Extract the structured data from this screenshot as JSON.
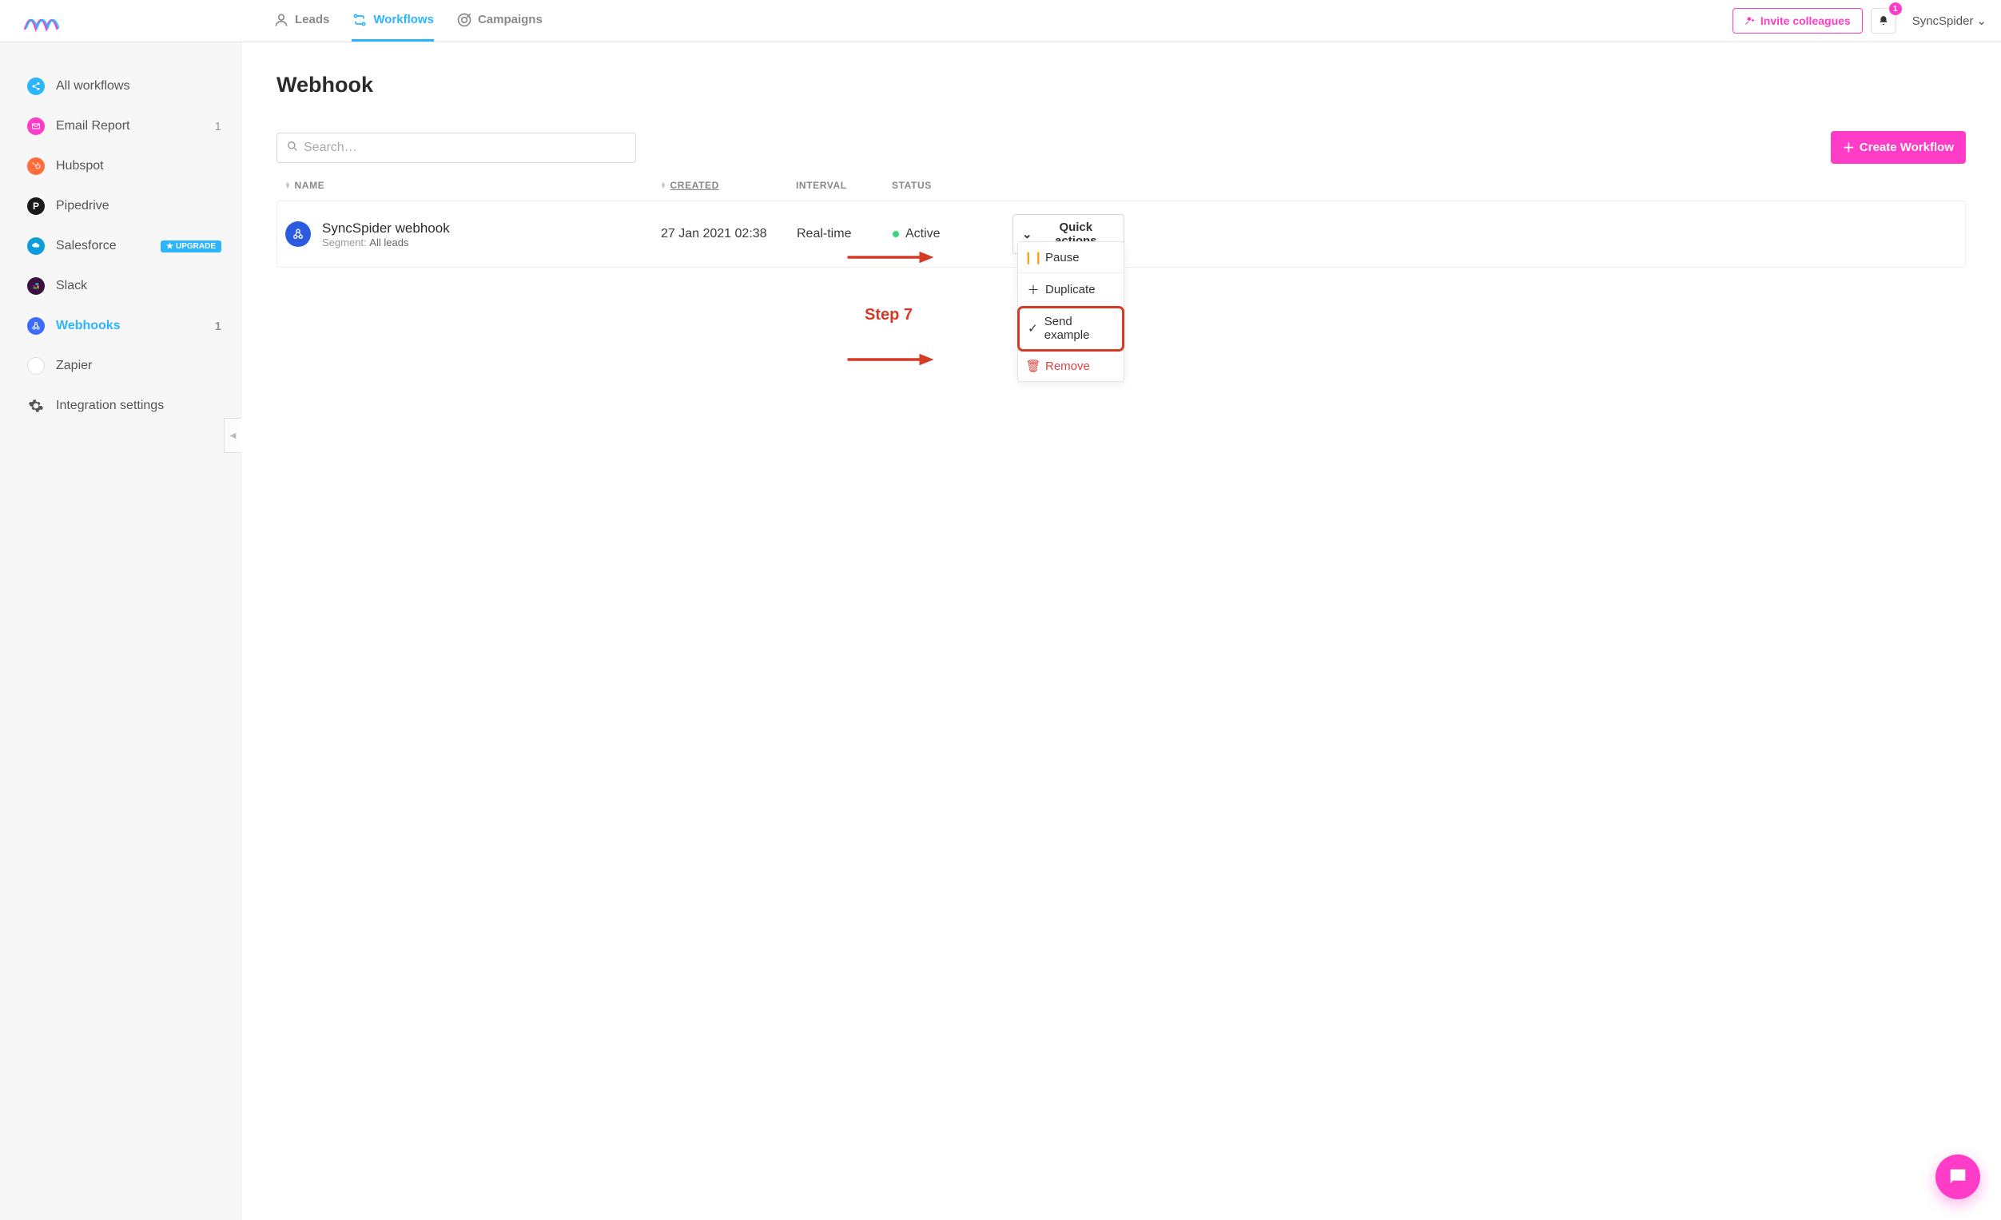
{
  "topnav": {
    "leads": "Leads",
    "workflows": "Workflows",
    "campaigns": "Campaigns"
  },
  "topright": {
    "invite_label": "Invite colleagues",
    "notif_count": "1",
    "user_label": "SyncSpider"
  },
  "sidebar": {
    "all_workflows": "All workflows",
    "email_report": {
      "label": "Email Report",
      "count": "1"
    },
    "hubspot": "Hubspot",
    "pipedrive": "Pipedrive",
    "salesforce": {
      "label": "Salesforce",
      "badge": "UPGRADE"
    },
    "slack": "Slack",
    "webhooks": {
      "label": "Webhooks",
      "count": "1"
    },
    "zapier": "Zapier",
    "integration_settings": "Integration settings"
  },
  "page": {
    "title": "Webhook",
    "search_placeholder": "Search…",
    "create_label": "Create Workflow"
  },
  "table": {
    "col_name": "NAME",
    "col_created": "CREATED",
    "col_interval": "INTERVAL",
    "col_status": "STATUS",
    "rows": [
      {
        "title": "SyncSpider webhook",
        "segment_label": "Segment:",
        "segment_value": "All leads",
        "created": "27 Jan 2021 02:38",
        "interval": "Real-time",
        "status": "Active"
      }
    ],
    "quick_actions": {
      "button": "Quick actions",
      "pause": "Pause",
      "duplicate": "Duplicate",
      "send_example": "Send example",
      "remove": "Remove"
    }
  },
  "annotation": {
    "step_label": "Step 7"
  }
}
